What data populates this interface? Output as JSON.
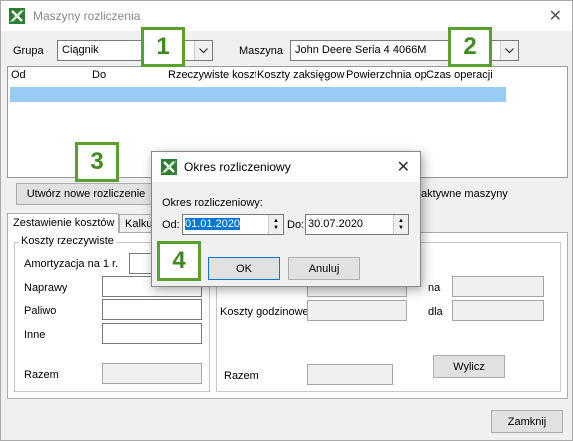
{
  "window": {
    "title": "Maszyny rozliczenia"
  },
  "filters": {
    "group_label": "Grupa",
    "group_value": "Ciągnik",
    "machine_label": "Maszyna",
    "machine_value": "John Deere Seria 4 4066M"
  },
  "badges": [
    "1",
    "2",
    "3",
    "4"
  ],
  "list": {
    "columns": [
      "Od",
      "Do",
      "Rzeczywiste koszt",
      "Koszty zaksięgow",
      "Powierzchnia op",
      "Czas operacji"
    ]
  },
  "buttons": {
    "create_new": "Utwórz nowe rozliczenie",
    "inactive_machines": "aktywne maszyny",
    "calculate": "Wylicz",
    "close": "Zamknij"
  },
  "tabs": [
    "Zestawienie kosztów",
    "Kalkul"
  ],
  "costs": {
    "real_costs_title": "Koszty rzeczywiste",
    "depreciation": "Amortyzacja na 1 r.",
    "repairs": "Naprawy",
    "fuel": "Paliwo",
    "other": "Inne",
    "total_left": "Razem",
    "hourly_costs": "Koszty godzinowe",
    "total_right": "Razem",
    "na": "na",
    "dla": "dla"
  },
  "dialog": {
    "title": "Okres rozliczeniowy",
    "period_label": "Okres rozliczeniowy:",
    "from_label": "Od:",
    "from_value": "01.01.2020",
    "to_label": "Do:",
    "to_value": "30.07.2020",
    "ok": "OK",
    "cancel": "Anuluj"
  },
  "colors": {
    "badge_border": "#5aa02c",
    "selection": "#99cbf5",
    "date_highlight": "#0078d7"
  }
}
